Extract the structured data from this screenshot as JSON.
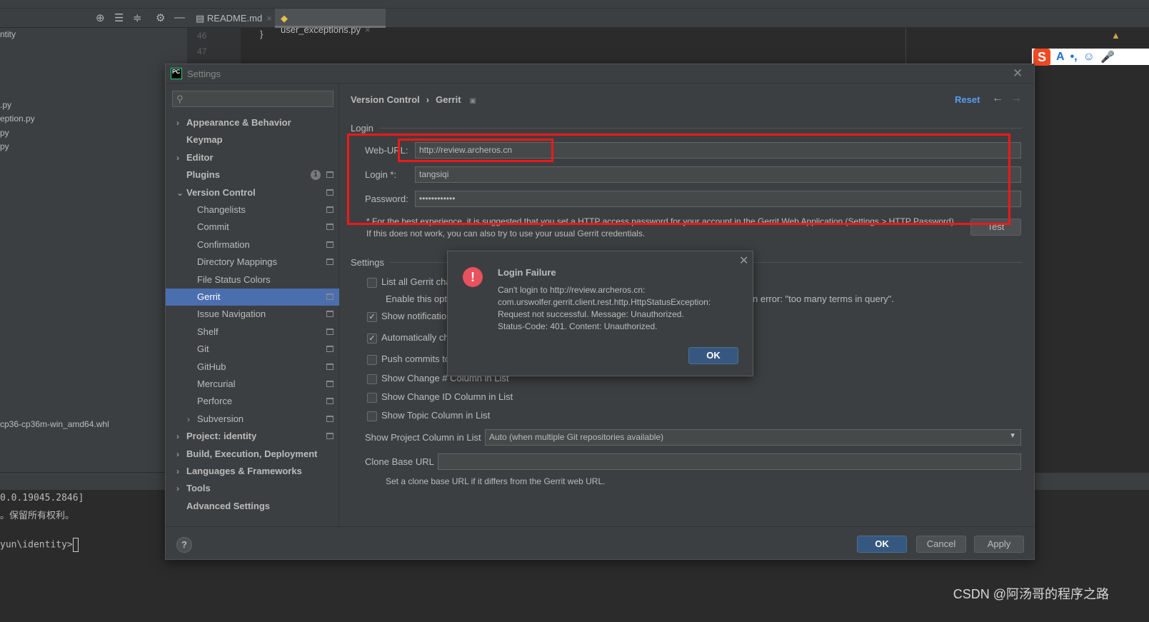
{
  "ide": {
    "tabs": [
      {
        "label": "README.md",
        "icon": "markdown-file-icon"
      },
      {
        "label": "user_exceptions.py",
        "icon": "python-file-icon"
      }
    ],
    "line_numbers": [
      "46",
      "47"
    ],
    "code_line": "}",
    "project_items": [
      "ntity",
      ".py",
      "eption.py",
      "py",
      "py",
      "cp36-cp36m-win_amd64.whl"
    ],
    "terminal_lines": [
      "0.0.19045.2846]",
      "。保留所有权利。",
      "",
      "yun\\identity>"
    ]
  },
  "ime_toolbar": {
    "logo": "S",
    "items": [
      "A",
      "•,",
      "☺",
      "🎤"
    ]
  },
  "settings": {
    "title": "Settings",
    "search_placeholder": "",
    "breadcrumb": [
      "Version Control",
      "Gerrit"
    ],
    "reset": "Reset",
    "sidebar": [
      {
        "label": "Appearance & Behavior",
        "bold": true,
        "arrow": "right",
        "level": 0
      },
      {
        "label": "Keymap",
        "bold": true,
        "level": 0
      },
      {
        "label": "Editor",
        "bold": true,
        "arrow": "right",
        "level": 0
      },
      {
        "label": "Plugins",
        "bold": true,
        "level": 0,
        "badge": "1",
        "proj": true
      },
      {
        "label": "Version Control",
        "bold": true,
        "arrow": "down",
        "level": 0,
        "proj": true
      },
      {
        "label": "Changelists",
        "level": 1,
        "proj": true
      },
      {
        "label": "Commit",
        "level": 1,
        "proj": true
      },
      {
        "label": "Confirmation",
        "level": 1,
        "proj": true
      },
      {
        "label": "Directory Mappings",
        "level": 1,
        "proj": true
      },
      {
        "label": "File Status Colors",
        "level": 1
      },
      {
        "label": "Gerrit",
        "level": 1,
        "proj": true,
        "selected": true
      },
      {
        "label": "Issue Navigation",
        "level": 1,
        "proj": true
      },
      {
        "label": "Shelf",
        "level": 1,
        "proj": true
      },
      {
        "label": "Git",
        "level": 1,
        "proj": true
      },
      {
        "label": "GitHub",
        "level": 1,
        "proj": true
      },
      {
        "label": "Mercurial",
        "level": 1,
        "proj": true
      },
      {
        "label": "Perforce",
        "level": 1,
        "proj": true
      },
      {
        "label": "Subversion",
        "level": 1,
        "arrow": "right",
        "proj": true
      },
      {
        "label": "Project: identity",
        "bold": true,
        "arrow": "right",
        "level": 0,
        "proj": true
      },
      {
        "label": "Build, Execution, Deployment",
        "bold": true,
        "arrow": "right",
        "level": 0
      },
      {
        "label": "Languages & Frameworks",
        "bold": true,
        "arrow": "right",
        "level": 0
      },
      {
        "label": "Tools",
        "bold": true,
        "arrow": "right",
        "level": 0
      },
      {
        "label": "Advanced Settings",
        "bold": true,
        "level": 0
      }
    ],
    "login": {
      "section": "Login",
      "web_url_label": "Web-URL:",
      "web_url": "http://review.archeros.cn",
      "login_label": "Login *:",
      "login": "tangsiqi",
      "password_label": "Password:",
      "password": "••••••••••••",
      "hint": "* For the best experience, it is suggested that you set a HTTP access password for your account in the Gerrit Web Application (Settings > HTTP Password). If this does not work, you can also try to use your usual Gerrit credentials.",
      "test": "Test"
    },
    "settings_section": "Settings",
    "options": [
      {
        "label": "List all Gerrit cha",
        "checked": false
      },
      {
        "label": "Show notification",
        "checked": true
      },
      {
        "label": "Automatically ch",
        "checked": true
      },
      {
        "label": "Push commits to",
        "checked": false
      },
      {
        "label": "Show Change # Column in List",
        "checked": false
      },
      {
        "label": "Show Change ID Column in List",
        "checked": false
      },
      {
        "label": "Show Topic Column in List",
        "checked": false
      }
    ],
    "enable_hint_left": "Enable this opt",
    "enable_hint_right": "n error: \"too many terms in query\".",
    "project_column_label": "Show Project Column in List",
    "project_column_value": "Auto (when multiple Git repositories available)",
    "clone_label": "Clone Base URL",
    "clone_value": "",
    "clone_hint": "Set a clone base URL if it differs from the Gerrit web URL.",
    "buttons": {
      "ok": "OK",
      "cancel": "Cancel",
      "apply": "Apply",
      "help": "?"
    }
  },
  "popup": {
    "title": "Login Failure",
    "lines": [
      "Can't login to http://review.archeros.cn:",
      "com.urswolfer.gerrit.client.rest.http.HttpStatusException:",
      "Request not successful. Message: Unauthorized.",
      "Status-Code: 401. Content: Unauthorized."
    ],
    "ok": "OK"
  },
  "watermark": "CSDN @阿汤哥的程序之路"
}
